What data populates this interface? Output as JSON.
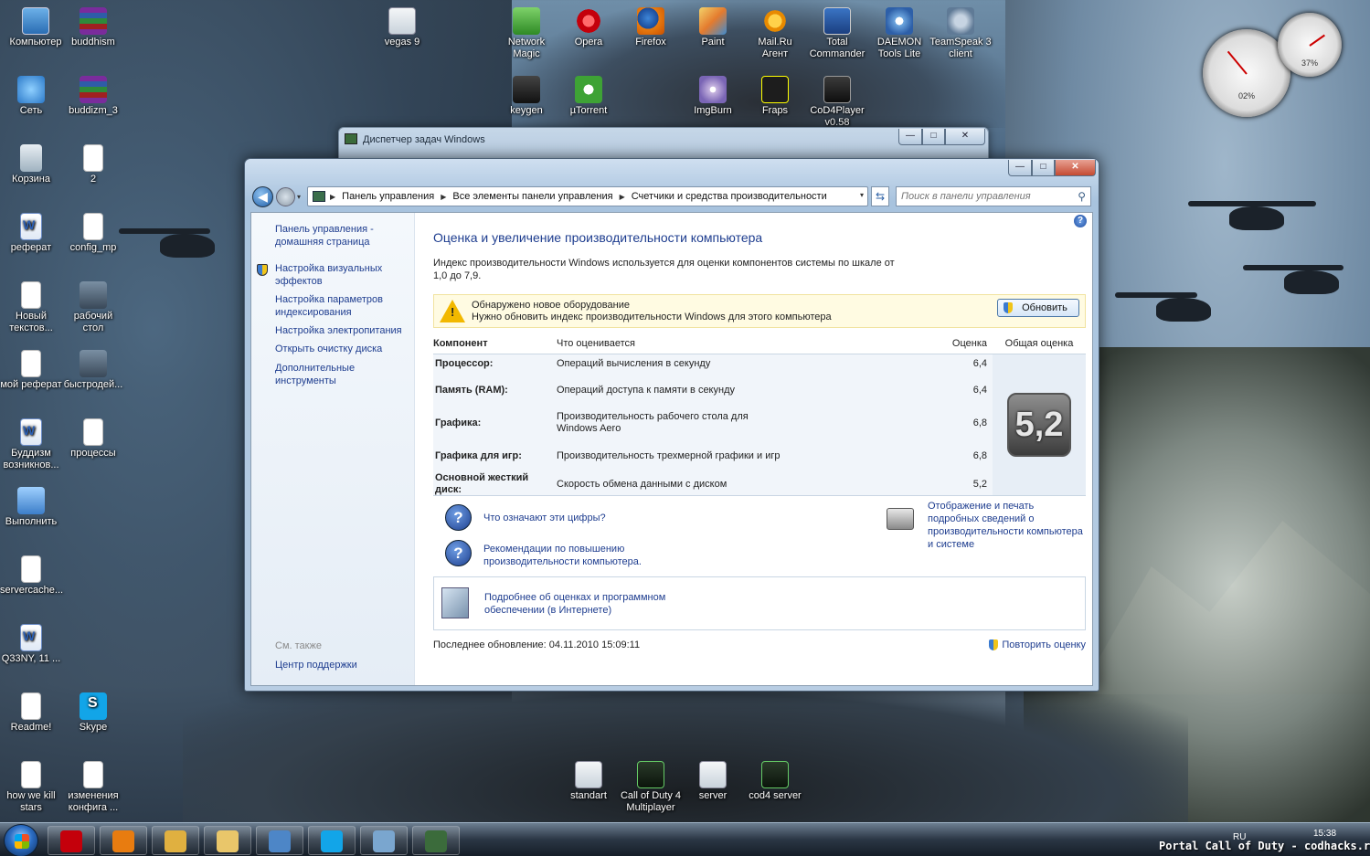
{
  "desktop": {
    "icons": [
      {
        "label": "Компьютер",
        "icon": "computer-icon"
      },
      {
        "label": "buddhism",
        "icon": "winrar-archive-icon"
      },
      {
        "label": "Сеть",
        "icon": "network-icon"
      },
      {
        "label": "buddizm_3",
        "icon": "winrar-archive-icon"
      },
      {
        "label": "Корзина",
        "icon": "recycle-bin-icon"
      },
      {
        "label": "2",
        "icon": "text-document-icon"
      },
      {
        "label": "реферат",
        "icon": "word-document-icon"
      },
      {
        "label": "config_mp",
        "icon": "text-document-icon"
      },
      {
        "label": "Новый текстов...",
        "icon": "text-document-icon"
      },
      {
        "label": "рабочий стол",
        "icon": "image-icon"
      },
      {
        "label": "мой реферат",
        "icon": "text-document-icon"
      },
      {
        "label": "быстродей...",
        "icon": "image-icon"
      },
      {
        "label": "Буддизм возникнов...",
        "icon": "word-document-icon"
      },
      {
        "label": "процессы",
        "icon": "document-icon"
      },
      {
        "label": "Выполнить",
        "icon": "run-icon"
      },
      {
        "label": "servercache...",
        "icon": "text-document-icon"
      },
      {
        "label": "Q33NY, 11 ...",
        "icon": "word-document-icon"
      },
      {
        "label": "Readme!",
        "icon": "text-document-icon"
      },
      {
        "label": "Skype",
        "icon": "skype-icon"
      },
      {
        "label": "how we kill stars",
        "icon": "text-document-icon"
      },
      {
        "label": "изменения конфига ...",
        "icon": "text-document-icon"
      },
      {
        "label": "vegas 9",
        "icon": "shortcut-icon"
      },
      {
        "label": "Network Magic",
        "icon": "network-magic-icon"
      },
      {
        "label": "Opera",
        "icon": "opera-icon"
      },
      {
        "label": "Firefox",
        "icon": "firefox-icon"
      },
      {
        "label": "Paint",
        "icon": "paint-icon"
      },
      {
        "label": "Mail.Ru Агент",
        "icon": "mailru-agent-icon"
      },
      {
        "label": "Total Commander",
        "icon": "total-commander-icon"
      },
      {
        "label": "DAEMON Tools Lite",
        "icon": "daemon-tools-icon"
      },
      {
        "label": "TeamSpeak 3 client",
        "icon": "teamspeak-icon"
      },
      {
        "label": "keygen",
        "icon": "keygen-icon"
      },
      {
        "label": "µTorrent",
        "icon": "utorrent-icon"
      },
      {
        "label": "ImgBurn",
        "icon": "imgburn-icon"
      },
      {
        "label": "Fraps",
        "icon": "fraps-icon"
      },
      {
        "label": "CoD4Player v0.58",
        "icon": "cod4player-icon"
      },
      {
        "label": "standart",
        "icon": "shortcut-icon"
      },
      {
        "label": "Call of Duty 4 Multiplayer",
        "icon": "cod4-icon"
      },
      {
        "label": "server",
        "icon": "shortcut-icon"
      },
      {
        "label": "cod4 server",
        "icon": "cod4-icon"
      }
    ],
    "gadget": {
      "cpu": "02%",
      "memory": "37%",
      "cpu_level": 0.02,
      "memory_level": 0.37
    }
  },
  "task_manager": {
    "title": "Диспетчер задач Windows"
  },
  "window": {
    "controls": {
      "minimize": "—",
      "maximize": "□",
      "close": "✕"
    },
    "nav": {
      "back": "◀",
      "dropdown": "▾"
    },
    "breadcrumbs": [
      "Панель управления",
      "Все элементы панели управления",
      "Счетчики и средства производительности"
    ],
    "breadcrumb_sep": "▶",
    "refresh": "⇆",
    "search_placeholder": "Поиск в панели управления",
    "help": "?",
    "sidebar": {
      "home": "Панель управления - домашняя страница",
      "links": [
        "Настройка визуальных эффектов",
        "Настройка параметров индексирования",
        "Настройка электропитания",
        "Открыть очистку диска",
        "Дополнительные инструменты"
      ],
      "see_also": "См. также",
      "support": "Центр поддержки"
    },
    "main": {
      "title": "Оценка и увеличение производительности компьютера",
      "intro": "Индекс производительности Windows используется для оценки компонентов системы по шкале от 1,0 до 7,9.",
      "warning": {
        "line1": "Обнаружено новое оборудование",
        "line2": "Нужно обновить индекс производительности Windows для этого компьютера",
        "button": "Обновить"
      },
      "table": {
        "headers": {
          "component": "Компонент",
          "what": "Что оценивается",
          "score": "Оценка",
          "base": "Общая оценка"
        },
        "rows": [
          {
            "component": "Процессор:",
            "what": "Операций вычисления в секунду",
            "score": "6,4"
          },
          {
            "component": "Память (RAM):",
            "what": "Операций доступа к памяти в секунду",
            "score": "6,4"
          },
          {
            "component": "Графика:",
            "what": "Производительность рабочего стола для Windows Aero",
            "score": "6,8"
          },
          {
            "component": "Графика для игр:",
            "what": "Производительность трехмерной графики и игр",
            "score": "6,8"
          },
          {
            "component": "Основной жесткий диск:",
            "what": "Скорость обмена данными с диском",
            "score": "5,2"
          }
        ],
        "base_score": "5,2"
      },
      "links": {
        "what_numbers": "Что означают эти цифры?",
        "recommendations": "Рекомендации по повышению производительности компьютера.",
        "print_details": "Отображение и печать подробных сведений о производительности компьютера и системе",
        "online_info": "Подробнее об оценках и программном обеспечении (в Интернете)"
      },
      "last_update": "Последнее обновление: 04.11.2010 15:09:11",
      "rerun": "Повторить оценку"
    }
  },
  "taskbar": {
    "items": [
      "opera-icon",
      "firefox-icon",
      "paint-icon",
      "explorer-icon",
      "control-panel-icon",
      "skype-icon",
      "window-switcher-icon",
      "task-manager-icon"
    ],
    "lang": "RU",
    "clock": "15:38"
  },
  "watermark": "Portal Call of Duty - codhacks.ru"
}
